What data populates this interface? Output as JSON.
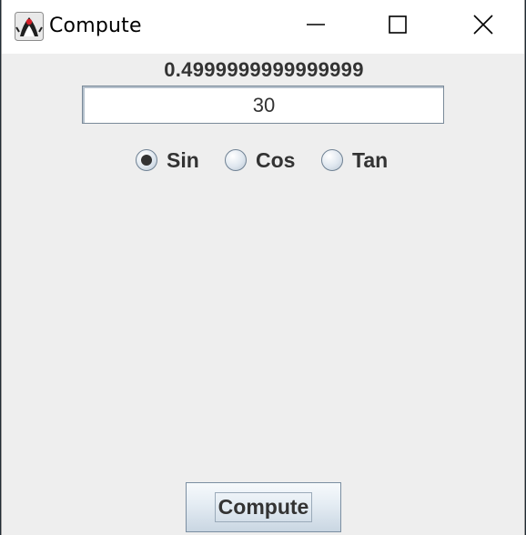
{
  "window": {
    "title": "Compute",
    "app_icon": "java-duke-icon",
    "controls": [
      "minimize-icon",
      "maximize-icon",
      "close-icon"
    ]
  },
  "result_label": "0.4999999999999999",
  "input": {
    "value": "30",
    "placeholder": ""
  },
  "radios": [
    {
      "label": "Sin",
      "selected": true
    },
    {
      "label": "Cos",
      "selected": false
    },
    {
      "label": "Tan",
      "selected": false
    }
  ],
  "compute_button": {
    "label": "Compute"
  }
}
